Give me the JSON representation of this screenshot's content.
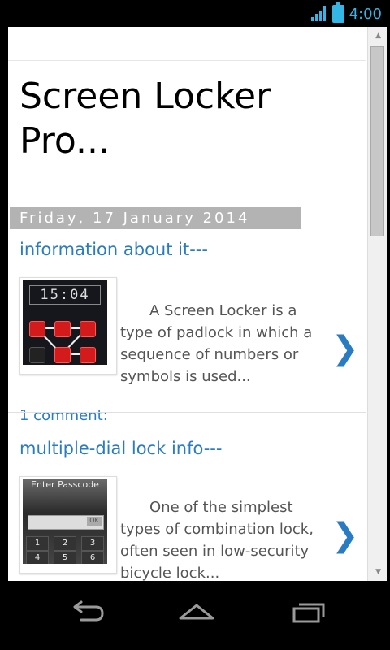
{
  "status_bar": {
    "time": "4:00",
    "signal_icon": "signal-icon",
    "battery_icon": "battery-icon"
  },
  "blog": {
    "title": "Screen Locker Pro...",
    "date": "Friday, 17 January 2014",
    "posts": [
      {
        "title": "information about it---",
        "snippet": "A Screen Locker   is a type of  padlock  in which a sequence of numbers or symbols is used...",
        "thumbnail_clock": "15:04",
        "comments": "1 comment:",
        "chevron": "❯"
      },
      {
        "title": "multiple-dial lock info---",
        "snippet": "One of the simplest types of combination lock, often seen in low-security  bicycle   lock...",
        "thumbnail_title": "Enter Passcode",
        "thumbnail_ok": "OK",
        "keys": [
          "1",
          "2",
          "3",
          "4",
          "5",
          "6"
        ],
        "chevron": "❯"
      }
    ]
  },
  "colors": {
    "link": "#2a7cc2",
    "accent": "#33b5e5",
    "date_bar": "#b3b3b3"
  },
  "nav": {
    "back_icon": "back-icon",
    "home_icon": "home-icon",
    "recents_icon": "recent-apps-icon"
  }
}
